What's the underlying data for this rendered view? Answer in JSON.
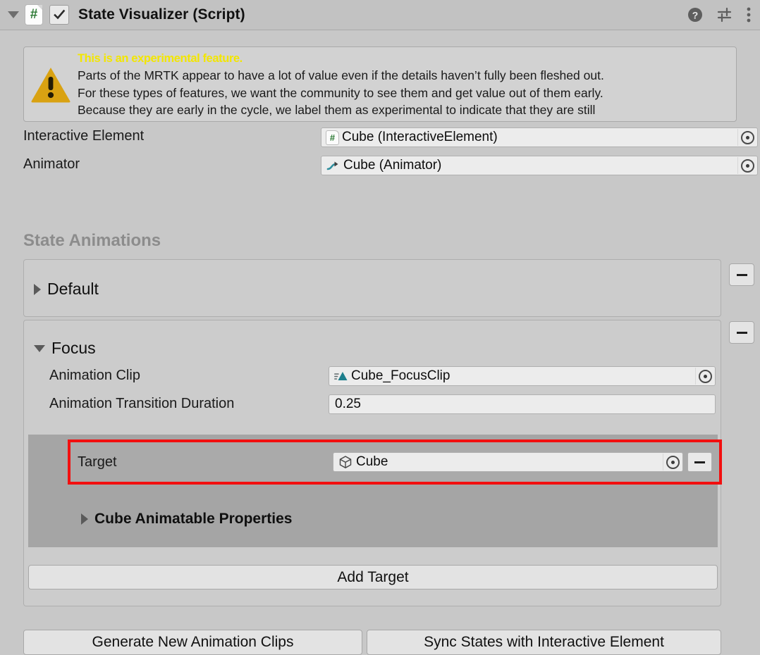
{
  "header": {
    "foldout_icon": "triangle-down-icon",
    "script_icon": "csharp-script-icon",
    "script_icon_glyph": "#",
    "enabled_checkbox": true,
    "title": "State Visualizer (Script)",
    "help_icon": "help-icon",
    "preset_icon": "preset-sliders-icon",
    "menu_icon": "kebab-menu-icon"
  },
  "warning": {
    "icon": "warning-triangle-icon",
    "title": "This is an experimental feature.",
    "line1": "Parts of the MRTK appear to have a lot of value even if the details haven’t fully been fleshed out.",
    "line2": "For these types of features, we want the community to see them and get value out of them early.",
    "line3": "Because they are early in the cycle, we label them as experimental to indicate that they are still",
    "title_color": "#f3e600"
  },
  "properties": {
    "interactive_element": {
      "label": "Interactive Element",
      "value": "Cube (InteractiveElement)",
      "icon": "csharp-script-icon",
      "icon_glyph": "#"
    },
    "animator": {
      "label": "Animator",
      "value": "Cube (Animator)",
      "icon": "animator-icon"
    }
  },
  "state_animations": {
    "title": "State Animations",
    "states": [
      {
        "name": "Default",
        "expanded": false,
        "remove_label": "−"
      },
      {
        "name": "Focus",
        "expanded": true,
        "remove_label": "−",
        "animation_clip": {
          "label": "Animation Clip",
          "value": "Cube_FocusClip",
          "icon": "animation-clip-icon"
        },
        "transition_duration": {
          "label": "Animation Transition Duration",
          "value": "0.25"
        },
        "target": {
          "label": "Target",
          "value": "Cube",
          "icon": "cube-gameobject-icon",
          "remove_label": "−",
          "highlighted": true,
          "highlight_color": "#f20f0f"
        },
        "animatable_properties": {
          "label": "Cube Animatable Properties",
          "expanded": false
        },
        "add_target_label": "Add Target"
      }
    ]
  },
  "footer": {
    "generate_clips_label": "Generate New Animation Clips",
    "sync_states_label": "Sync States with Interactive Element"
  }
}
